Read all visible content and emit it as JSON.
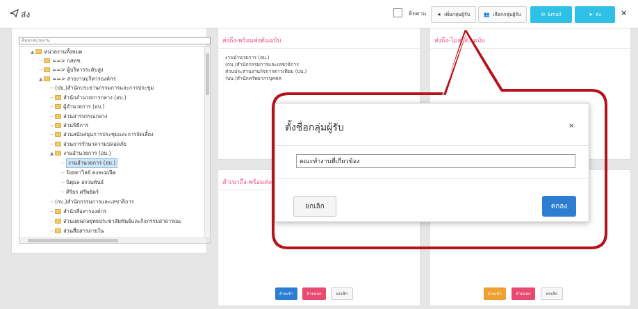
{
  "topbar": {
    "title": "ส่ง",
    "follow_label": "ติดตาม",
    "add_group_label": "เพิ่มกลุ่มผู้รับ",
    "choose_group_label": "เลือกกลุ่มผู้รับ",
    "email_label": "Email",
    "send_label": "ส่ง",
    "close": "×"
  },
  "tree": {
    "search_placeholder": "ค้นหาหน่วยงาน",
    "items": [
      {
        "label": "หน่วยงานทั้งหมด"
      },
      {
        "label": "==> กสทช."
      },
      {
        "label": "==> ผู้บริหารระดับสูง"
      },
      {
        "label": "==> สายงานบริหารองค์กร"
      },
      {
        "label": "(ปบ.)สำนักประธานกรรมการและการประชุม"
      },
      {
        "label": "สำนักอำนวยการกลาง (อบ.)"
      },
      {
        "label": "ผู้อำนวยการ (อบ.)"
      },
      {
        "label": "ส่วนสารบรรณกลาง"
      },
      {
        "label": "ส่วนพิธีการ"
      },
      {
        "label": "ส่วนสนับสนุนการประชุมและการจัดเลี้ยง"
      },
      {
        "label": "ส่วนการรักษาความปลอดภัย"
      },
      {
        "label": "งานอำนวยการ (อบ.)"
      },
      {
        "label": "งานอำนวยการ (อบ.)"
      },
      {
        "label": "ร้อยตาวิลย์ คงละมณีต"
      },
      {
        "label": "นิตุมล สงวนพันธ์"
      },
      {
        "label": "ศิริธร ศรีพยัคร์"
      },
      {
        "label": "(กบ.)สำนักกรรมการและเลขาธิการ"
      },
      {
        "label": "สำนักสื่อสารองค์กร"
      },
      {
        "label": "ส่วนแผนกลยุทธประชาสัมพันธ์และกิจกรรมสาธารณะ"
      },
      {
        "label": "ส่วนสื่อสารภายใน"
      }
    ]
  },
  "panels": {
    "send_with_original": {
      "title": "ส่งถึง-พร้อมส่งต้นฉบับ",
      "items": [
        "งานอำนวยการ (อบ.)",
        "(กบ.)สำนักกรรมการและเลขาธิการ",
        "ส่วนประสานงานกิจการดาวเทียม (ปบ.)",
        "(บบ.)สำนักทรัพยากรบุคคล"
      ]
    },
    "send_without_original": {
      "title": "ส่งถึง-ไม่ส่งต้นฉบับ"
    },
    "copy_with_original": {
      "title": "สำเนาถึง-พร้อมส่งต้นฉบับ"
    },
    "buttons": {
      "in": "ย้ายเข้า",
      "out": "ย้ายออก",
      "cancel": "ยกเลิก"
    }
  },
  "modal": {
    "title": "ตั้งชื่อกลุ่มผู้รับ",
    "close": "×",
    "input_value": "คณะทำงานที่เกี่ยวข้อง",
    "cancel_label": "ยกเลิก",
    "ok_label": "ตกลง"
  },
  "colors": {
    "accent_teal": "#2fc0e6",
    "accent_blue": "#2d7dd2",
    "pink": "#e94a72",
    "orange": "#f0a030",
    "callout_red": "#b5121b"
  }
}
